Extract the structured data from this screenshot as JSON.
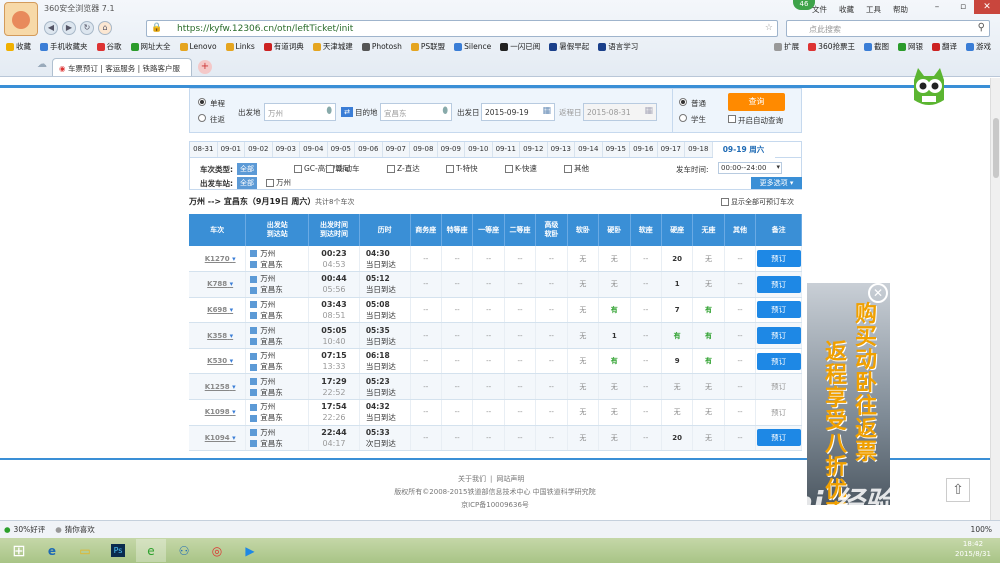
{
  "browser": {
    "app_title": "360安全浏览器 7.1",
    "badge": "46",
    "menu": [
      "文件",
      "收藏",
      "工具",
      "帮助"
    ],
    "url": "https://kyfw.12306.cn/otn/leftTicket/init",
    "search_placeholder": "点此搜索",
    "bookmarks": [
      "收藏",
      "手机收藏夹",
      "谷歌",
      "网址大全",
      "Lenovo",
      "Links",
      "有道词典",
      "天津城建",
      "Photosh",
      "PS联盟",
      "Silence",
      "一闪已阅",
      "暑假早起",
      "语言学习"
    ],
    "bookmarks_right": [
      "扩展",
      "360抢票王",
      "截图",
      "网银",
      "翻译",
      "游戏"
    ],
    "tab_title": "车票预订 | 客运服务 | 铁路客户服",
    "status_left": "30%好评",
    "status_left2": "猜你喜欢",
    "zoom": "100%",
    "clock_time": "18:42",
    "clock_date": "2015/8/31"
  },
  "query": {
    "trip_types": [
      "单程",
      "往返"
    ],
    "from_label": "出发地",
    "from_value": "万州",
    "to_label": "目的地",
    "to_value": "宜昌东",
    "date_label": "出发日",
    "date_value": "2015-09-19",
    "return_label": "返程日",
    "return_value": "2015-08-31",
    "passenger_types": [
      "普通",
      "学生"
    ],
    "query_button": "查询",
    "auto_query": "开启自动查询"
  },
  "date_tabs": [
    "08-31",
    "09-01",
    "09-02",
    "09-03",
    "09-04",
    "09-05",
    "09-06",
    "09-07",
    "09-08",
    "09-09",
    "09-10",
    "09-11",
    "09-12",
    "09-13",
    "09-14",
    "09-15",
    "09-16",
    "09-17",
    "09-18"
  ],
  "date_active": "09-19 周六",
  "filters": {
    "type_label": "车次类型:",
    "all": "全部",
    "types": [
      "GC-高铁/城际",
      "D-动车",
      "Z-直达",
      "T-特快",
      "K-快速",
      "其他"
    ],
    "station_label": "出发车站:",
    "station_all": "全部",
    "stations": [
      "万州"
    ],
    "time_label": "发车时间:",
    "time_value": "00:00--24:00",
    "more_options": "更多选项"
  },
  "summary": {
    "route": "万州 --> 宜昌东（9月19日  周六）",
    "count": "共计8个车次",
    "show_all": "显示全部可预订车次"
  },
  "table": {
    "headers": [
      "车次",
      "出发站\n到达站",
      "出发时间\n到达时间",
      "历时",
      "商务座",
      "特等座",
      "一等座",
      "二等座",
      "高级\n软卧",
      "软卧",
      "硬卧",
      "软座",
      "硬座",
      "无座",
      "其他",
      "备注"
    ],
    "rows": [
      {
        "train": "K1270",
        "from": "万州",
        "to": "宜昌东",
        "dep": "00:23",
        "arr": "04:53",
        "dur": "04:30",
        "day": "当日到达",
        "seats": [
          "--",
          "--",
          "--",
          "--",
          "--",
          "无",
          "无",
          "--",
          "20",
          "无",
          "--"
        ],
        "action": "预订",
        "bookable": true
      },
      {
        "train": "K788",
        "from": "万州",
        "to": "宜昌东",
        "dep": "00:44",
        "arr": "05:56",
        "dur": "05:12",
        "day": "当日到达",
        "seats": [
          "--",
          "--",
          "--",
          "--",
          "--",
          "无",
          "无",
          "--",
          "1",
          "无",
          "--"
        ],
        "action": "预订",
        "bookable": true
      },
      {
        "train": "K698",
        "from": "万州",
        "to": "宜昌东",
        "dep": "03:43",
        "arr": "08:51",
        "dur": "05:08",
        "day": "当日到达",
        "seats": [
          "--",
          "--",
          "--",
          "--",
          "--",
          "无",
          "有",
          "--",
          "7",
          "有",
          "--"
        ],
        "action": "预订",
        "bookable": true
      },
      {
        "train": "K358",
        "from": "万州",
        "to": "宜昌东",
        "dep": "05:05",
        "arr": "10:40",
        "dur": "05:35",
        "day": "当日到达",
        "seats": [
          "--",
          "--",
          "--",
          "--",
          "--",
          "无",
          "1",
          "--",
          "有",
          "有",
          "--"
        ],
        "action": "预订",
        "bookable": true
      },
      {
        "train": "K530",
        "from": "万州",
        "to": "宜昌东",
        "dep": "07:15",
        "arr": "13:33",
        "dur": "06:18",
        "day": "当日到达",
        "seats": [
          "--",
          "--",
          "--",
          "--",
          "--",
          "无",
          "有",
          "--",
          "9",
          "有",
          "--"
        ],
        "action": "预订",
        "bookable": true
      },
      {
        "train": "K1258",
        "from": "万州",
        "to": "宜昌东",
        "dep": "17:29",
        "arr": "22:52",
        "dur": "05:23",
        "day": "当日到达",
        "seats": [
          "--",
          "--",
          "--",
          "--",
          "--",
          "无",
          "无",
          "--",
          "无",
          "无",
          "--"
        ],
        "action": "预订",
        "bookable": false
      },
      {
        "train": "K1098",
        "from": "万州",
        "to": "宜昌东",
        "dep": "17:54",
        "arr": "22:26",
        "dur": "04:32",
        "day": "当日到达",
        "seats": [
          "--",
          "--",
          "--",
          "--",
          "--",
          "无",
          "无",
          "--",
          "无",
          "无",
          "--"
        ],
        "action": "预订",
        "bookable": false
      },
      {
        "train": "K1094",
        "from": "万州",
        "to": "宜昌东",
        "dep": "22:44",
        "arr": "04:17",
        "dur": "05:33",
        "day": "次日到达",
        "seats": [
          "--",
          "--",
          "--",
          "--",
          "--",
          "无",
          "无",
          "--",
          "20",
          "无",
          "--"
        ],
        "action": "预订",
        "bookable": true
      }
    ]
  },
  "footer": {
    "links": [
      "关于我们",
      "网站声明"
    ],
    "copyright": "版权所有©2008-2015铁道部信息技术中心   中国铁道科学研究院",
    "icp": "京ICP备10009636号"
  },
  "ad": {
    "lines": [
      "购买动卧往返票",
      "返程享受八折优惠"
    ]
  },
  "watermark": "Bai 经验",
  "colors": {
    "accent": "#3a8fd6",
    "book_button": "#1e88e5",
    "query_button": "#ff8a00",
    "have": "#2ca02c"
  }
}
